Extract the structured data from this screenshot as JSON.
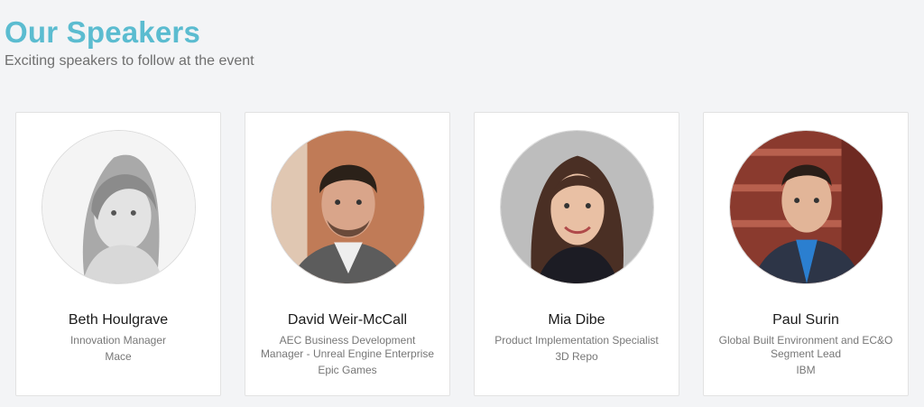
{
  "header": {
    "title": "Our Speakers",
    "subtitle": "Exciting speakers to follow at the event"
  },
  "speakers": [
    {
      "name": "Beth Houlgrave",
      "role": "Innovation Manager",
      "company": "Mace",
      "photo": "portrait-bw"
    },
    {
      "name": "David Weir-McCall",
      "role": "AEC Business Development Manager - Unreal Engine Enterprise",
      "company": "Epic Games",
      "photo": "portrait-warm"
    },
    {
      "name": "Mia Dibe",
      "role": "Product Implementation Specialist",
      "company": "3D Repo",
      "photo": "portrait-grey"
    },
    {
      "name": "Paul Surin",
      "role": "Global Built Environment and EC&O Segment Lead",
      "company": "IBM",
      "photo": "portrait-brick"
    }
  ],
  "colors": {
    "accent": "#5bbcd0",
    "background": "#f3f4f6"
  }
}
